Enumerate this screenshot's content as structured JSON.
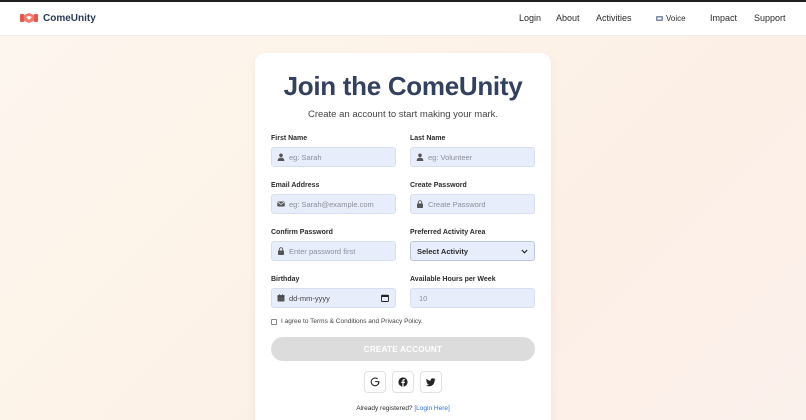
{
  "brand": {
    "name": "ComeUnity",
    "logo_icon": "handshake-icon",
    "accent": "#e4574b"
  },
  "nav": {
    "login": "Login",
    "about": "About",
    "activities": "Activities",
    "voice": "Voice",
    "voice_icon": "voice-icon",
    "impact": "Impact",
    "support": "Support"
  },
  "form": {
    "title": "Join the ComeUnity",
    "subtitle": "Create an account to start making your mark.",
    "first_name": {
      "label": "First Name",
      "placeholder": "eg: Sarah",
      "icon": "user-icon"
    },
    "last_name": {
      "label": "Last Name",
      "placeholder": "eg: Volunteer",
      "icon": "user-icon"
    },
    "email": {
      "label": "Email Address",
      "placeholder": "eg: Sarah@example.com",
      "icon": "envelope-icon"
    },
    "password": {
      "label": "Create Password",
      "placeholder": "Create Password",
      "icon": "lock-icon"
    },
    "confirm_password": {
      "label": "Confirm Password",
      "placeholder": "Enter password first",
      "icon": "lock-icon"
    },
    "activity_area": {
      "label": "Preferred Activity Area",
      "selected": "Select Activity"
    },
    "birthday": {
      "label": "Birthday",
      "value": "dd-mm-yyyy",
      "icon": "calendar-icon"
    },
    "hours": {
      "label": "Available Hours per Week",
      "value": "10"
    },
    "agree_text": "I agree to Terms & Conditions and Privacy Policy.",
    "create_button": "CREATE ACCOUNT",
    "already_text": "Already registered?",
    "login_link": "[Login Here]"
  },
  "social": [
    "google-icon",
    "facebook-icon",
    "twitter-icon"
  ],
  "colors": {
    "title": "#33405e",
    "field_bg": "#e8edfb",
    "button_disabled": "#dcdcdc",
    "link": "#2f6fdc"
  }
}
